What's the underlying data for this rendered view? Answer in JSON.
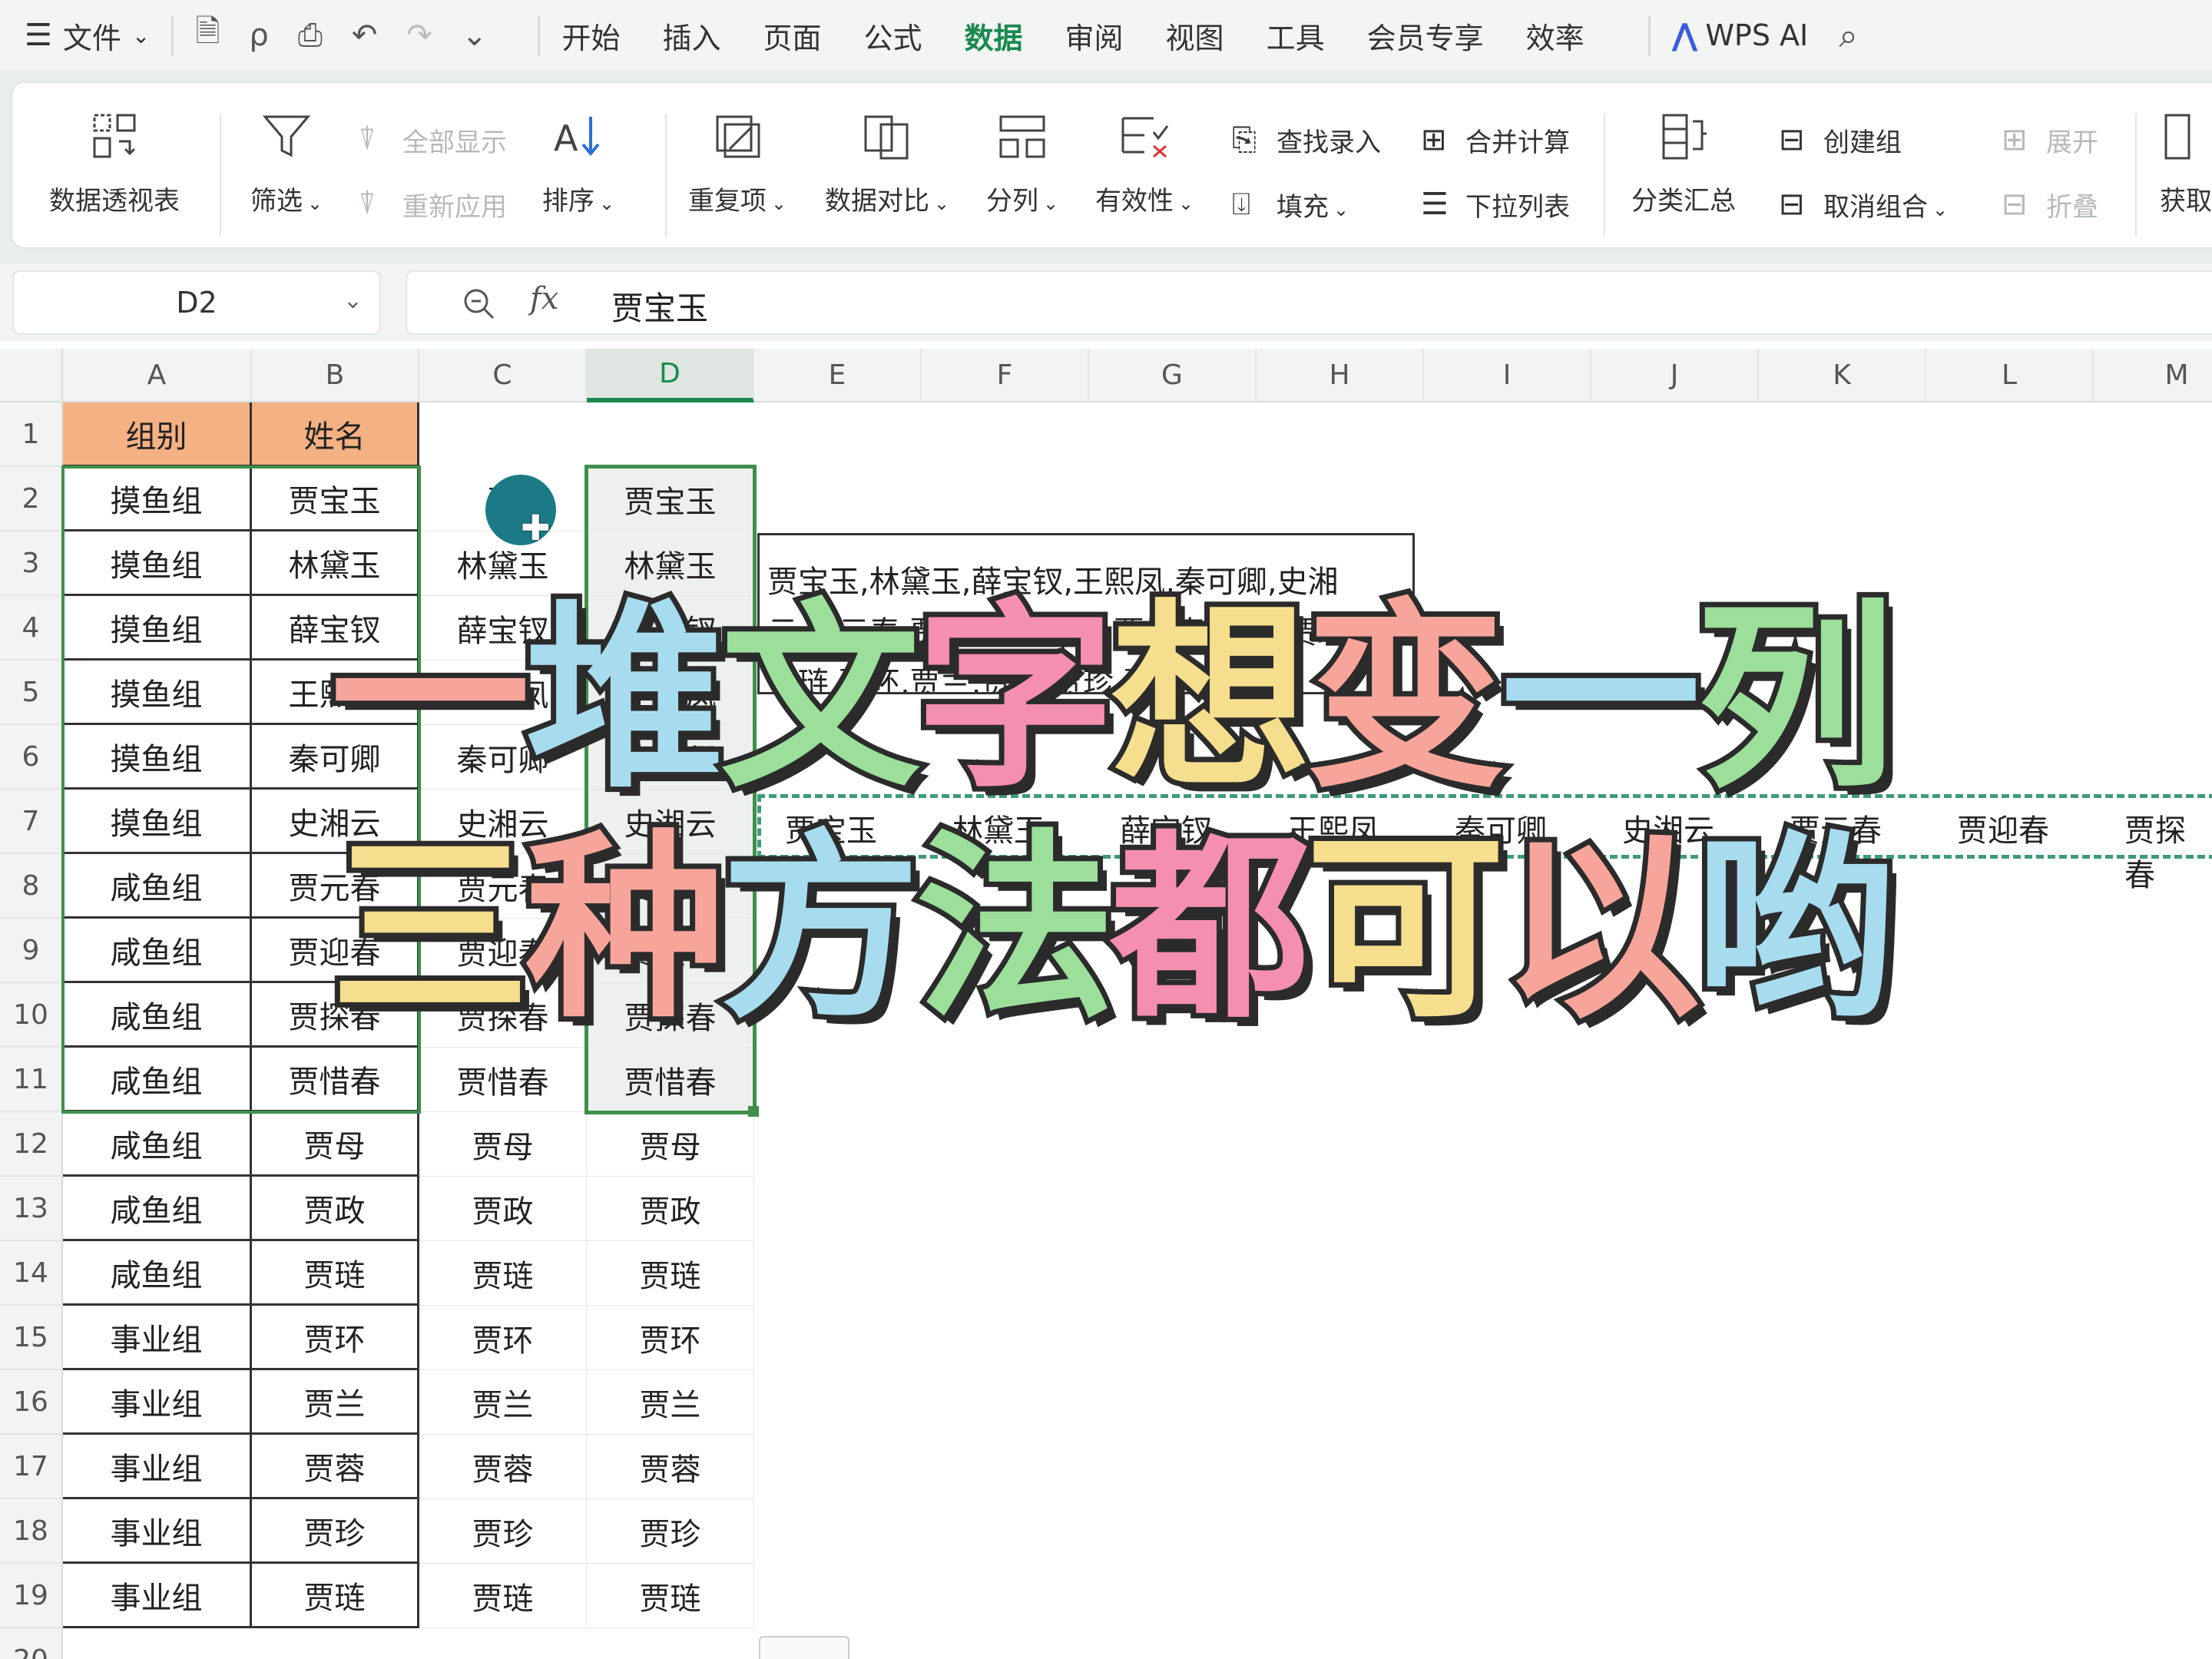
{
  "menu": {
    "file_label": "文件",
    "tabs": [
      "开始",
      "插入",
      "页面",
      "公式",
      "数据",
      "审阅",
      "视图",
      "工具",
      "会员专享",
      "效率"
    ],
    "active_tab": "数据",
    "wps_ai": "WPS AI"
  },
  "ribbon": {
    "pivot": "数据透视表",
    "filter": "筛选",
    "show_all": "全部显示",
    "reapply": "重新应用",
    "sort": "排序",
    "duplicates": "重复项",
    "compare": "数据对比",
    "split": "分列",
    "validity": "有效性",
    "lookup_entry": "查找录入",
    "fill": "填充",
    "consolidate": "合并计算",
    "dropdown_list": "下拉列表",
    "subtotal": "分类汇总",
    "create_group": "创建组",
    "ungroup": "取消组合",
    "expand": "展开",
    "collapse": "折叠",
    "get": "获取"
  },
  "formula_bar": {
    "cell_ref": "D2",
    "fx": "fx",
    "value": "贾宝玉"
  },
  "sheet": {
    "columns": [
      "A",
      "B",
      "C",
      "D",
      "E",
      "F",
      "G",
      "H",
      "I",
      "J",
      "K",
      "L",
      "M"
    ],
    "selected_column": "D",
    "rows": [
      "1",
      "2",
      "3",
      "4",
      "5",
      "6",
      "7",
      "8",
      "9",
      "10",
      "11",
      "12",
      "13",
      "14",
      "15",
      "16",
      "17",
      "18",
      "19",
      "20"
    ],
    "header_row": [
      "组别",
      "姓名"
    ],
    "col_a": [
      "摸鱼组",
      "摸鱼组",
      "摸鱼组",
      "摸鱼组",
      "摸鱼组",
      "摸鱼组",
      "咸鱼组",
      "咸鱼组",
      "咸鱼组",
      "咸鱼组",
      "咸鱼组",
      "咸鱼组",
      "咸鱼组",
      "事业组",
      "事业组",
      "事业组",
      "事业组",
      "事业组"
    ],
    "col_b": [
      "贾宝玉",
      "林黛玉",
      "薛宝钗",
      "王熙凤",
      "秦可卿",
      "史湘云",
      "贾元春",
      "贾迎春",
      "贾探春",
      "贾惜春",
      "贾母",
      "贾政",
      "贾琏",
      "贾环",
      "贾兰",
      "贾蓉",
      "贾珍",
      "贾琏"
    ],
    "col_c": [
      "贾",
      "林黛玉",
      "薛宝钗",
      "王熙凤",
      "秦可卿",
      "史湘云",
      "贾元春",
      "贾迎春",
      "贾探春",
      "贾惜春",
      "贾母",
      "贾政",
      "贾琏",
      "贾环",
      "贾兰",
      "贾蓉",
      "贾珍",
      "贾琏"
    ],
    "col_d": [
      "贾宝玉",
      "林黛玉",
      "薛宝钗",
      "王熙凤",
      "秦可卿",
      "史湘云",
      "贾元春",
      "贾迎春",
      "贾探春",
      "贾惜春",
      "贾母",
      "贾政",
      "贾琏",
      "贾环",
      "贾兰",
      "贾蓉",
      "贾珍",
      "贾琏"
    ],
    "textbox_lines": [
      "贾宝玉,林黛玉,薛宝钗,王熙凤,秦可卿,史湘",
      "云,贾元春,贾迎春,贾探春,贾惜春,贾母,贾政",
      "贾琏,贾环,贾兰,贾蓉,贾珍,贾琏"
    ],
    "row7_names": [
      "贾宝玉",
      "林黛玉",
      "薛宝钗",
      "王熙凤",
      "秦可卿",
      "史湘云",
      "贾元春",
      "贾迎春",
      "贾探春"
    ]
  },
  "overlay": {
    "line1": [
      "一",
      "堆",
      "文",
      "字",
      "想",
      "变",
      "一",
      "列"
    ],
    "line2": [
      "三",
      "种",
      "方",
      "法",
      "都",
      "可",
      "以",
      "哟"
    ],
    "colors": [
      "#f7a59a",
      "#a7dcef",
      "#9bdf9b",
      "#f58fb0",
      "#f6de8f"
    ]
  }
}
